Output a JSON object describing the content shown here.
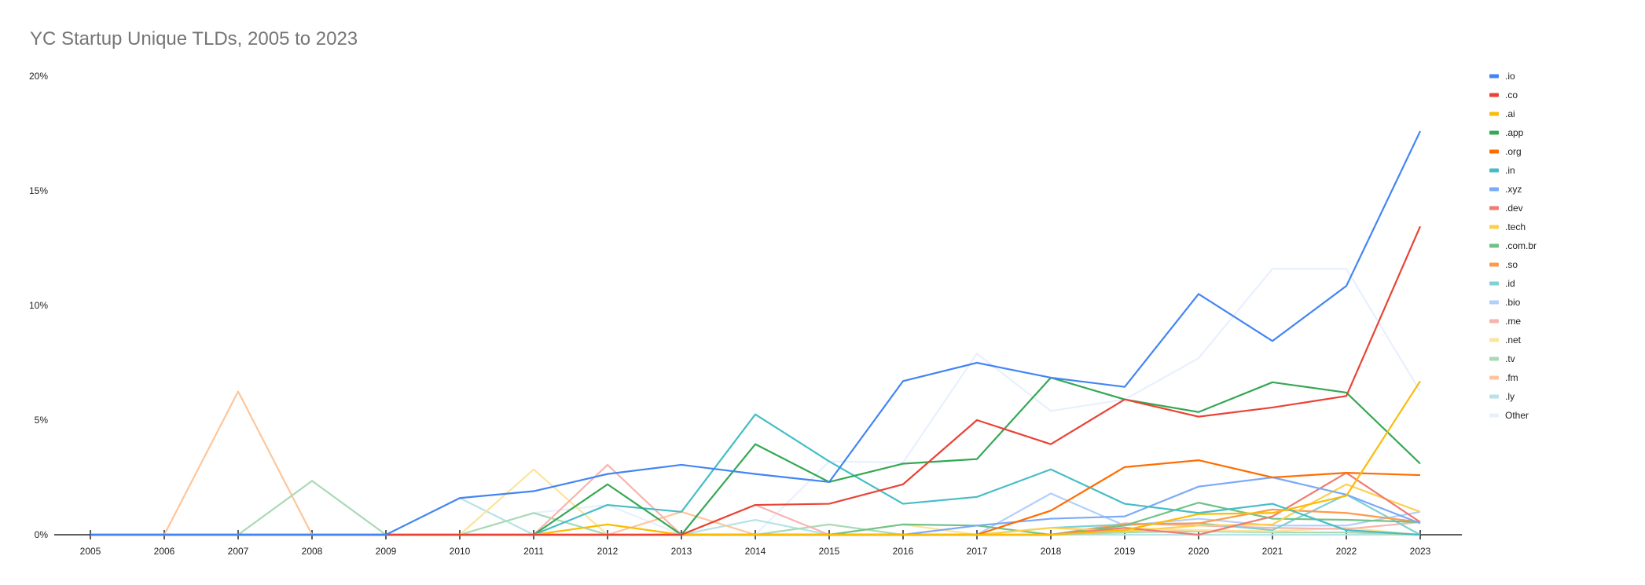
{
  "chart_data": {
    "type": "line",
    "title": "YC Startup Unique TLDs, 2005 to 2023",
    "xlabel": "",
    "ylabel": "",
    "x": [
      "2005",
      "2006",
      "2007",
      "2008",
      "2009",
      "2010",
      "2011",
      "2012",
      "2013",
      "2014",
      "2015",
      "2016",
      "2017",
      "2018",
      "2019",
      "2020",
      "2021",
      "2022",
      "2023"
    ],
    "ylim": [
      0,
      20
    ],
    "yticks": [
      0,
      5,
      10,
      15,
      20
    ],
    "ytick_labels": [
      "0%",
      "5%",
      "10%",
      "15%",
      "20%"
    ],
    "grid": false,
    "legend_position": "right",
    "series": [
      {
        "name": ".io",
        "color": "#4285f4",
        "values": [
          0,
          0,
          0,
          0,
          0,
          1.6,
          1.9,
          2.65,
          3.05,
          2.65,
          2.3,
          6.7,
          7.5,
          6.85,
          6.45,
          10.5,
          8.45,
          10.85,
          17.6
        ]
      },
      {
        "name": ".co",
        "color": "#ea4335",
        "values": [
          0,
          0,
          0,
          0,
          0,
          0,
          0,
          0,
          0,
          1.3,
          1.35,
          2.2,
          5.0,
          3.95,
          5.9,
          5.15,
          5.55,
          6.05,
          13.45
        ]
      },
      {
        "name": ".ai",
        "color": "#fbbc04",
        "values": [
          0,
          0,
          0,
          0,
          0,
          0,
          0,
          0.45,
          0,
          0,
          0,
          0,
          0,
          0,
          0.2,
          0.9,
          0.95,
          1.7,
          6.7
        ]
      },
      {
        "name": ".app",
        "color": "#34a853",
        "values": [
          0,
          0,
          0,
          0,
          0,
          0,
          0,
          2.2,
          0,
          3.95,
          2.3,
          3.1,
          3.3,
          6.85,
          5.9,
          5.35,
          6.65,
          6.2,
          3.1
        ]
      },
      {
        "name": ".org",
        "color": "#ff6d01",
        "values": [
          0,
          0,
          0,
          0,
          0,
          0,
          0,
          0,
          0,
          0,
          0,
          0,
          0,
          1.05,
          2.95,
          3.25,
          2.5,
          2.7,
          2.6
        ]
      },
      {
        "name": ".in",
        "color": "#46bdc6",
        "values": [
          0,
          0,
          0,
          0,
          0,
          0,
          0,
          1.3,
          1.0,
          5.25,
          3.2,
          1.35,
          1.65,
          2.85,
          1.35,
          0.95,
          1.35,
          0.2,
          0
        ]
      },
      {
        "name": ".xyz",
        "color": "#7baaf7",
        "values": [
          0,
          0,
          0,
          0,
          0,
          0,
          0,
          0,
          0,
          0,
          0,
          0,
          0.4,
          0.7,
          0.8,
          2.1,
          2.5,
          1.75,
          0.5
        ]
      },
      {
        "name": ".dev",
        "color": "#f07b72",
        "values": [
          0,
          0,
          0,
          0,
          0,
          0,
          0,
          0,
          0,
          0,
          0,
          0,
          0,
          0,
          0.3,
          0,
          0.8,
          2.7,
          0.55
        ]
      },
      {
        "name": ".tech",
        "color": "#fcd04f",
        "values": [
          0,
          0,
          0,
          0,
          0,
          0,
          0,
          0,
          0,
          0,
          0,
          0,
          0,
          0.3,
          0.15,
          0.4,
          0.45,
          2.2,
          1.0
        ]
      },
      {
        "name": ".com.br",
        "color": "#71c287",
        "values": [
          0,
          0,
          0,
          0,
          0,
          0,
          0,
          0,
          0,
          0,
          0,
          0.45,
          0.4,
          0,
          0.4,
          1.4,
          0.7,
          0.65,
          0.55
        ]
      },
      {
        "name": ".so",
        "color": "#ff994d",
        "values": [
          0,
          0,
          0,
          0,
          0,
          0,
          0,
          0,
          0,
          0,
          0,
          0,
          0,
          0,
          0.45,
          0.5,
          1.1,
          0.95,
          0.55
        ]
      },
      {
        "name": ".id",
        "color": "#7ed1d7",
        "values": [
          0,
          0,
          0,
          0,
          0,
          0,
          0,
          0,
          0,
          0,
          0,
          0,
          0,
          0.3,
          0.45,
          0.5,
          0.2,
          1.75,
          0
        ]
      },
      {
        "name": ".bio",
        "color": "#b3cefb",
        "values": [
          0,
          0,
          0,
          0,
          0,
          0,
          0,
          0,
          0,
          0,
          0,
          0,
          0,
          1.8,
          0.4,
          0.7,
          0.4,
          0.4,
          1.0
        ]
      },
      {
        "name": ".me",
        "color": "#f7b4ae",
        "values": [
          0,
          0,
          0,
          0,
          0,
          0,
          0,
          3.05,
          0,
          1.3,
          0,
          0,
          0,
          0,
          0.5,
          0.4,
          0.3,
          0.25,
          0.55
        ]
      },
      {
        "name": ".net",
        "color": "#fde49b",
        "values": [
          0,
          0,
          0,
          0,
          0,
          0,
          2.85,
          0,
          0,
          0,
          0,
          0.45,
          0,
          0,
          0.3,
          0.2,
          0.15,
          0.3,
          0
        ]
      },
      {
        "name": ".tv",
        "color": "#a8dab5",
        "values": [
          0,
          0,
          0,
          2.35,
          0,
          0,
          0.95,
          0,
          0,
          0,
          0.45,
          0,
          0,
          0,
          0.1,
          0.15,
          0.1,
          0.1,
          0
        ]
      },
      {
        "name": ".fm",
        "color": "#ffc599",
        "values": [
          0,
          0,
          6.25,
          0,
          0,
          0,
          0,
          0,
          1.0,
          0,
          0,
          0,
          0,
          0,
          0.1,
          0.2,
          0.1,
          0.1,
          0
        ]
      },
      {
        "name": ".ly",
        "color": "#b5e3e6",
        "values": [
          0,
          0,
          0,
          0,
          0,
          1.6,
          0,
          0,
          0,
          0.65,
          0,
          0,
          0,
          0,
          0,
          0,
          0,
          0,
          0
        ]
      },
      {
        "name": "Other",
        "color": "#e8f0fe",
        "values": [
          0,
          0,
          0,
          0,
          0,
          0,
          0.95,
          1.3,
          0,
          0,
          3.2,
          3.15,
          7.9,
          5.4,
          5.9,
          7.7,
          11.6,
          11.6,
          6.25
        ]
      }
    ]
  }
}
